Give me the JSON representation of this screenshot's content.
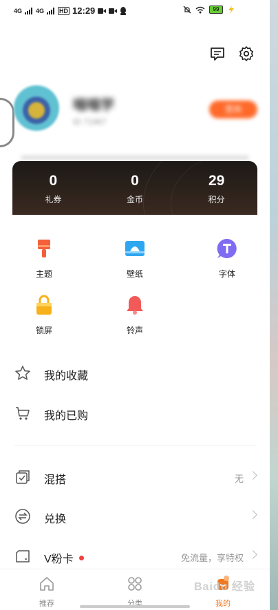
{
  "status_bar": {
    "network1": "4G",
    "network2": "4G",
    "hd": "HD",
    "time": "12:29",
    "battery": "99"
  },
  "profile": {
    "username": "喵喵学",
    "user_id": "ID 71967",
    "action_label": "签到"
  },
  "stats": [
    {
      "value": "0",
      "label": "礼券"
    },
    {
      "value": "0",
      "label": "金币"
    },
    {
      "value": "29",
      "label": "积分"
    }
  ],
  "grid": [
    {
      "label": "主题",
      "icon": "brush-icon",
      "color": "#f4603a"
    },
    {
      "label": "壁纸",
      "icon": "wallpaper-icon",
      "color": "#2fa6f0"
    },
    {
      "label": "字体",
      "icon": "font-icon",
      "color": "#7f6cf2"
    },
    {
      "label": "锁屏",
      "icon": "lock-icon",
      "color": "#f7b21b"
    },
    {
      "label": "铃声",
      "icon": "bell-icon",
      "color": "#f25a5a"
    }
  ],
  "menu": {
    "favorites": {
      "label": "我的收藏"
    },
    "purchased": {
      "label": "我的已购"
    },
    "mix": {
      "label": "混搭",
      "value": "无"
    },
    "exchange": {
      "label": "兑换"
    },
    "vcard": {
      "label": "V粉卡",
      "value": "免流量，享特权"
    }
  },
  "bottom_nav": [
    {
      "label": "推荐",
      "icon": "home-icon"
    },
    {
      "label": "分类",
      "icon": "category-icon"
    },
    {
      "label": "我的",
      "icon": "profile-icon",
      "active": true
    }
  ],
  "watermark": "Baidu 经验",
  "colors": {
    "accent": "#f0781e",
    "card_bg": "#221c18"
  }
}
